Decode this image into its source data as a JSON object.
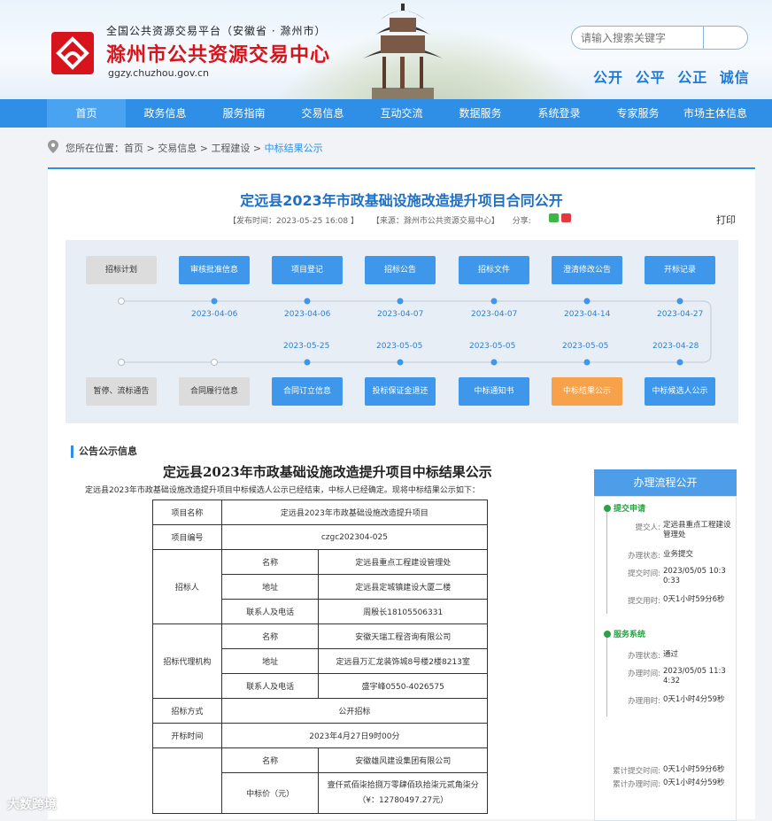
{
  "header": {
    "subtitle": "全国公共资源交易平台（安徽省 · 滁州市）",
    "title": "滁州市公共资源交易中心",
    "url": "ggzy.chuzhou.gov.cn",
    "search_placeholder": "请输入搜索关键字",
    "slogans": [
      "公开",
      "公平",
      "公正",
      "诚信"
    ],
    "colors": {
      "brand_red": "#d7141b",
      "nav_blue": "#2f8fe6"
    }
  },
  "nav": {
    "items": [
      "首页",
      "政务信息",
      "服务指南",
      "交易信息",
      "互动交流",
      "数据服务",
      "系统登录",
      "专家服务",
      "市场主体信息"
    ]
  },
  "breadcrumb": {
    "prefix": "您所在位置：",
    "path": [
      "首页",
      "交易信息",
      "工程建设"
    ],
    "current": "中标结果公示",
    "separator": " > "
  },
  "article": {
    "title": "定远县2023年市政基础设施改造提升项目合同公开",
    "publish_time": "【发布时间：2023-05-25 16:08 】",
    "source": "【来源：滁州市公共资源交易中心】",
    "share_label": "分享:",
    "print_label": "打印"
  },
  "flow": {
    "top_row": [
      "招标计划",
      "审核批准信息",
      "项目登记",
      "招标公告",
      "招标文件",
      "澄清修改公告",
      "开标记录"
    ],
    "top_dates": [
      "2023-04-06",
      "2023-04-06",
      "2023-04-07",
      "2023-04-07",
      "2023-04-14",
      "2023-04-27"
    ],
    "bottom_row": [
      "暂停、流标通告",
      "合同履行信息",
      "合同订立信息",
      "投标保证金退还",
      "中标通知书",
      "中标结果公示",
      "中标候选人公示"
    ],
    "bottom_dates": [
      "2023-05-25",
      "2023-05-05",
      "2023-05-05",
      "2023-05-05",
      "2023-04-28"
    ]
  },
  "announcement": {
    "section_label": "公告公示信息",
    "title": "定远县2023年市政基础设施改造提升项目中标结果公示",
    "intro": "定远县2023年市政基础设施改造提升项目中标候选人公示已经结束，中标人已经确定。现将中标结果公示如下：",
    "table": {
      "project_name_label": "项目名称",
      "project_name": "定远县2023年市政基础设施改造提升项目",
      "project_no_label": "项目编号",
      "project_no": "czgc202304-025",
      "tenderer_label": "招标人",
      "agency_label": "招标代理机构",
      "winner_label": "",
      "name_label": "名称",
      "address_label": "地址",
      "contact_label": "联系人及电话",
      "tenderer_name": "定远县重点工程建设管理处",
      "tenderer_address": "定远县定城镇建设大厦二楼",
      "tenderer_contact": "周殷长18105506331",
      "agency_name": "安徽天瑞工程咨询有限公司",
      "agency_address": "定远县万汇龙装饰城8号楼2楼8213室",
      "agency_contact": "盛宇峰0550-4026575",
      "method_label": "招标方式",
      "method": "公开招标",
      "open_time_label": "开标时间",
      "open_time": "2023年4月27日9时00分",
      "winner_name": "安徽雄风建设集团有限公司",
      "price_label": "中标价（元）",
      "price": "壹仟贰佰柒拾捌万零肆佰玖拾柒元贰角柒分（¥：12780497.27元）"
    }
  },
  "process": {
    "title": "办理流程公开",
    "steps": [
      {
        "name": "提交申请",
        "rows": [
          {
            "label": "提交人:",
            "value": "定远县重点工程建设管理处"
          },
          {
            "label": "办理状态:",
            "value": "业务提交"
          },
          {
            "label": "提交时间:",
            "value": "2023/05/05 10:30:33"
          },
          {
            "label": "提交用时:",
            "value": "0天1小时59分6秒"
          }
        ]
      },
      {
        "name": "服务系统",
        "rows": [
          {
            "label": "办理状态:",
            "value": "通过"
          },
          {
            "label": "办理时间:",
            "value": "2023/05/05 11:34:32"
          },
          {
            "label": "办理用时:",
            "value": "0天1小时4分59秒"
          }
        ]
      }
    ],
    "totals": [
      {
        "label": "累计提交时间:",
        "value": "0天1小时59分6秒"
      },
      {
        "label": "累计办理时间:",
        "value": "0天1小时4分59秒"
      }
    ]
  },
  "watermark": "大数跨境"
}
